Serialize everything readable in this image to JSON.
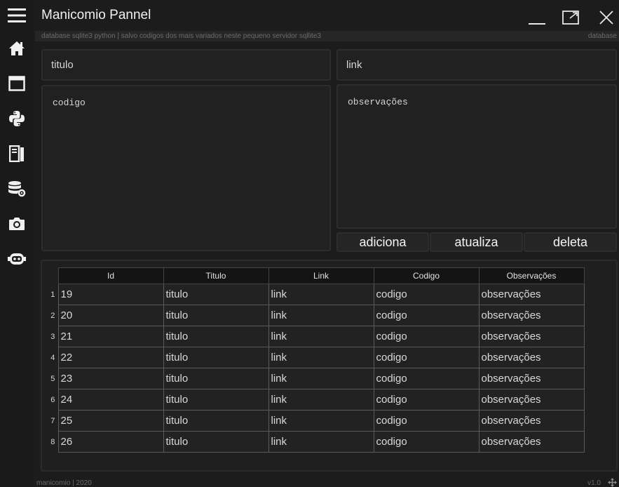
{
  "window": {
    "title": "Manicomio Pannel",
    "controls": [
      "minimize-icon",
      "maximize-icon",
      "close-icon"
    ]
  },
  "sidebar": {
    "items": [
      {
        "icon": "hamburger-menu-icon"
      },
      {
        "icon": "home-icon"
      },
      {
        "icon": "browser-window-icon"
      },
      {
        "icon": "python-logo-icon"
      },
      {
        "icon": "server-icon"
      },
      {
        "icon": "database-gear-icon"
      },
      {
        "icon": "camera-icon"
      },
      {
        "icon": "robot-icon"
      }
    ]
  },
  "info_bar": {
    "left": "database sqlite3 python | salvo codigos dos mais variados neste pequeno servidor sqllite3",
    "right": "database"
  },
  "form": {
    "titulo": "titulo",
    "link": "link",
    "codigo": "codigo",
    "observacoes": "observações"
  },
  "actions": {
    "adiciona": "adiciona",
    "atualiza": "atualiza",
    "deleta": "deleta"
  },
  "table": {
    "headers": [
      "Id",
      "Titulo",
      "Link",
      "Codigo",
      "Observações"
    ],
    "rows": [
      {
        "num": "1",
        "id": "19",
        "titulo": "titulo",
        "link": "link",
        "codigo": "codigo",
        "obs": "observações"
      },
      {
        "num": "2",
        "id": "20",
        "titulo": "titulo",
        "link": "link",
        "codigo": "codigo",
        "obs": "observações"
      },
      {
        "num": "3",
        "id": "21",
        "titulo": "titulo",
        "link": "link",
        "codigo": "codigo",
        "obs": "observações"
      },
      {
        "num": "4",
        "id": "22",
        "titulo": "titulo",
        "link": "link",
        "codigo": "codigo",
        "obs": "observações"
      },
      {
        "num": "5",
        "id": "23",
        "titulo": "titulo",
        "link": "link",
        "codigo": "codigo",
        "obs": "observações"
      },
      {
        "num": "6",
        "id": "24",
        "titulo": "titulo",
        "link": "link",
        "codigo": "codigo",
        "obs": "observações"
      },
      {
        "num": "7",
        "id": "25",
        "titulo": "titulo",
        "link": "link",
        "codigo": "codigo",
        "obs": "observações"
      },
      {
        "num": "8",
        "id": "26",
        "titulo": "titulo",
        "link": "link",
        "codigo": "codigo",
        "obs": "observações"
      }
    ]
  },
  "status": {
    "left": "manicomio | 2020",
    "right": "v1.0",
    "grip_icon": "resize-grip-icon"
  },
  "colors": {
    "background": "#1c1c1c",
    "sidebar": "#1a1a1a",
    "field": "#212121",
    "header": "#141414",
    "text": "#d8d8d8"
  }
}
